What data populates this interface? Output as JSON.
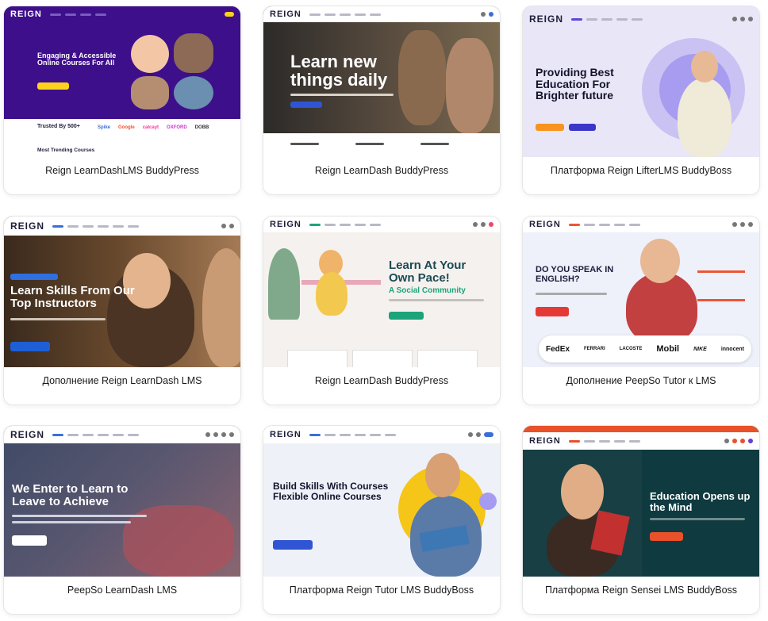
{
  "cards": [
    {
      "caption": "Reign LearnDashLMS BuddyPress",
      "logo": "REIGN",
      "headline": "Engaging & Accessible Online Courses For All",
      "extra": "Trusted By 500+",
      "section": "Most Trending Courses"
    },
    {
      "caption": "Reign LearnDash BuddyPress",
      "logo": "REIGN",
      "headline": "Learn new things daily"
    },
    {
      "caption": "Платформа Reign LifterLMS BuddyBoss",
      "logo": "REIGN",
      "headline": "Providing Best Education For Brighter future"
    },
    {
      "caption": "Дополнение Reign LearnDash LMS",
      "logo": "REIGN",
      "headline": "Learn Skills From Our Top Instructors"
    },
    {
      "caption": "Reign LearnDash BuddyPress",
      "logo": "REIGN",
      "headline": "Learn At Your Own Pace!",
      "extra": "A Social Community"
    },
    {
      "caption": "Дополнение PeepSo Tutor к LMS",
      "logo": "REIGN",
      "headline": "DO YOU SPEAK IN ENGLISH?",
      "brands": [
        "FedEx",
        "FERRARI",
        "LACOSTE",
        "Mobil",
        "NIKE",
        "innocent"
      ]
    },
    {
      "caption": "PeepSo LearnDash LMS",
      "logo": "REIGN",
      "headline": "We Enter to Learn to Leave to Achieve"
    },
    {
      "caption": "Платформа Reign Tutor LMS BuddyBoss",
      "logo": "REIGN",
      "headline": "Build Skills With Courses Flexible Online Courses"
    },
    {
      "caption": "Платформа Reign Sensei LMS BuddyBoss",
      "logo": "REIGN",
      "headline": "Education Opens up the Mind"
    }
  ]
}
